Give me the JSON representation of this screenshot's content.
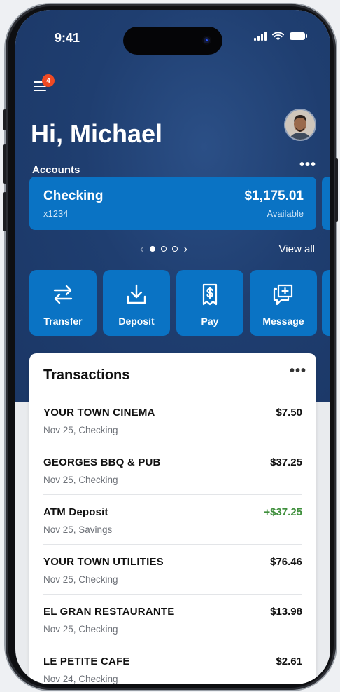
{
  "status_bar": {
    "time": "9:41"
  },
  "menu": {
    "badge_count": "4"
  },
  "greeting": "Hi, Michael",
  "accounts": {
    "label": "Accounts",
    "more": "•••",
    "card": {
      "name": "Checking",
      "number": "x1234",
      "balance": "$1,175.01",
      "balance_label": "Available"
    },
    "pager": {
      "prev": "‹",
      "next": "›",
      "page_count": 3,
      "active_index": 0
    },
    "view_all": "View all"
  },
  "actions": [
    {
      "label": "Transfer",
      "icon": "transfer-icon"
    },
    {
      "label": "Deposit",
      "icon": "deposit-icon"
    },
    {
      "label": "Pay",
      "icon": "pay-icon"
    },
    {
      "label": "Message",
      "icon": "message-icon"
    }
  ],
  "transactions": {
    "title": "Transactions",
    "more": "•••",
    "items": [
      {
        "merchant": "YOUR TOWN CINEMA",
        "sub": "Nov 25, Checking",
        "amount": "$7.50",
        "credit": false
      },
      {
        "merchant": "GEORGES BBQ & PUB",
        "sub": "Nov 25, Checking",
        "amount": "$37.25",
        "credit": false
      },
      {
        "merchant": "ATM Deposit",
        "sub": "Nov 25, Savings",
        "amount": "+$37.25",
        "credit": true
      },
      {
        "merchant": "YOUR TOWN UTILITIES",
        "sub": "Nov 25, Checking",
        "amount": "$76.46",
        "credit": false
      },
      {
        "merchant": "EL GRAN RESTAURANTE",
        "sub": "Nov 25, Checking",
        "amount": "$13.98",
        "credit": false
      },
      {
        "merchant": "LE PETITE CAFE",
        "sub": "Nov 24, Checking",
        "amount": "$2.61",
        "credit": false
      }
    ]
  },
  "colors": {
    "hero": "#1f3e70",
    "accent_blue": "#0a73c4",
    "badge": "#f04a23",
    "credit_green": "#3f8f3c"
  }
}
